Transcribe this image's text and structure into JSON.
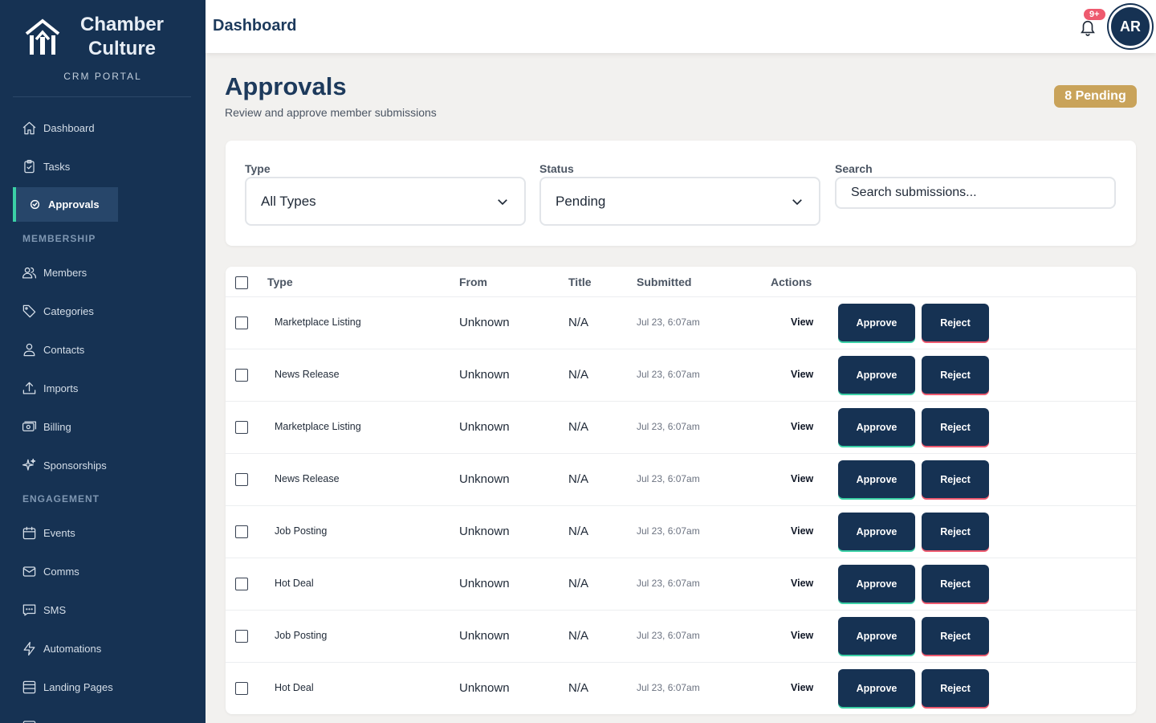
{
  "brand": {
    "name": "Chamber Culture",
    "subtitle": "CRM PORTAL"
  },
  "sidebar": {
    "items": [
      {
        "label": "Dashboard",
        "icon": "home-icon"
      },
      {
        "label": "Tasks",
        "icon": "clipboard-icon"
      },
      {
        "label": "Approvals",
        "icon": "check-circle-icon",
        "active": true
      }
    ],
    "membership_section": "MEMBERSHIP",
    "membership_items": [
      {
        "label": "Members",
        "icon": "users-icon"
      },
      {
        "label": "Categories",
        "icon": "tag-icon"
      },
      {
        "label": "Contacts",
        "icon": "user-icon"
      },
      {
        "label": "Imports",
        "icon": "upload-icon"
      },
      {
        "label": "Billing",
        "icon": "billing-icon"
      },
      {
        "label": "Sponsorships",
        "icon": "sparkles-icon"
      }
    ],
    "engagement_section": "ENGAGEMENT",
    "engagement_items": [
      {
        "label": "Events",
        "icon": "calendar-icon"
      },
      {
        "label": "Comms",
        "icon": "mail-icon"
      },
      {
        "label": "SMS",
        "icon": "message-icon"
      },
      {
        "label": "Automations",
        "icon": "bolt-icon"
      },
      {
        "label": "Landing Pages",
        "icon": "page-icon"
      }
    ]
  },
  "topbar": {
    "title": "Dashboard",
    "notification_count": "9+",
    "avatar_initials": "AR"
  },
  "page": {
    "title": "Approvals",
    "subtitle": "Review and approve member submissions",
    "pending_badge": "8 Pending"
  },
  "filters": {
    "type_label": "Type",
    "type_value": "All Types",
    "status_label": "Status",
    "status_value": "Pending",
    "search_label": "Search",
    "search_placeholder": "Search submissions..."
  },
  "table": {
    "headers": {
      "type": "Type",
      "from": "From",
      "title": "Title",
      "submitted": "Submitted",
      "actions": "Actions"
    },
    "view_label": "View",
    "approve_label": "Approve",
    "reject_label": "Reject",
    "rows": [
      {
        "type": "Marketplace Listing",
        "from": "Unknown",
        "title": "N/A",
        "submitted": "Jul 23, 6:07am"
      },
      {
        "type": "News Release",
        "from": "Unknown",
        "title": "N/A",
        "submitted": "Jul 23, 6:07am"
      },
      {
        "type": "Marketplace Listing",
        "from": "Unknown",
        "title": "N/A",
        "submitted": "Jul 23, 6:07am"
      },
      {
        "type": "News Release",
        "from": "Unknown",
        "title": "N/A",
        "submitted": "Jul 23, 6:07am"
      },
      {
        "type": "Job Posting",
        "from": "Unknown",
        "title": "N/A",
        "submitted": "Jul 23, 6:07am"
      },
      {
        "type": "Hot Deal",
        "from": "Unknown",
        "title": "N/A",
        "submitted": "Jul 23, 6:07am"
      },
      {
        "type": "Job Posting",
        "from": "Unknown",
        "title": "N/A",
        "submitted": "Jul 23, 6:07am"
      },
      {
        "type": "Hot Deal",
        "from": "Unknown",
        "title": "N/A",
        "submitted": "Jul 23, 6:07am"
      }
    ]
  },
  "colors": {
    "sidebar": "#163253",
    "accent_green": "#3bd0a6",
    "accent_red": "#ee5a6f",
    "badge_gold": "#c9a35a"
  }
}
